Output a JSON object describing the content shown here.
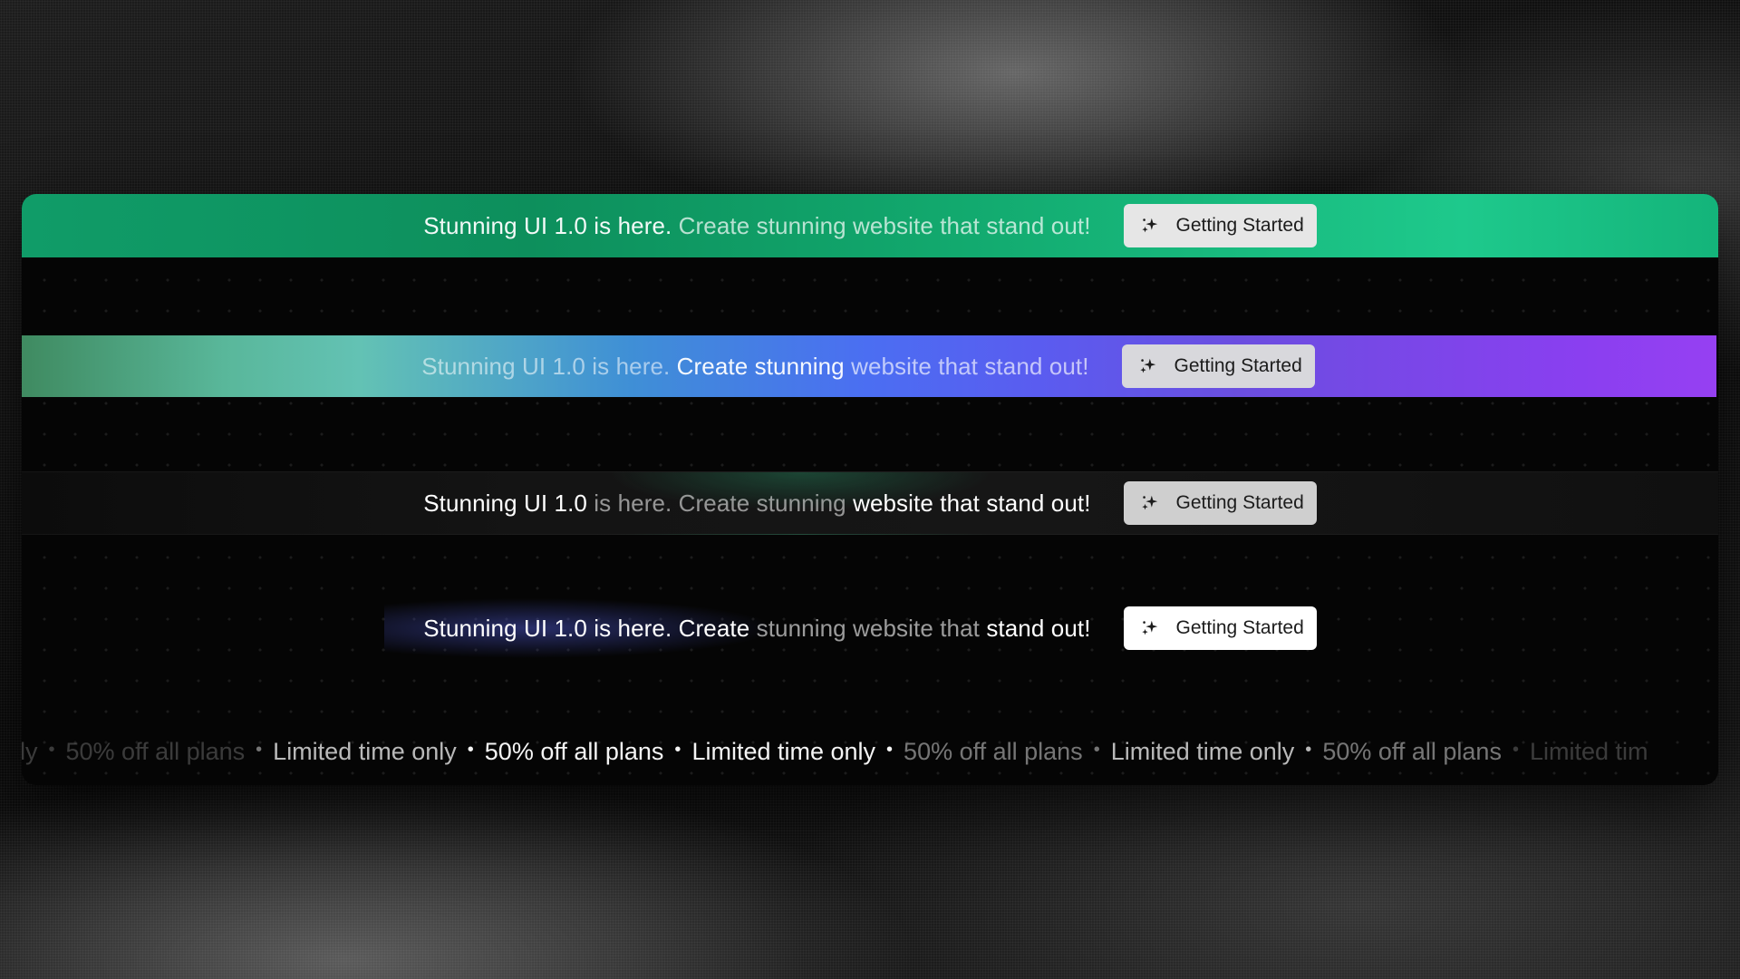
{
  "banners": [
    {
      "part1": "Stunning UI 1.0 is here.",
      "part2": "Create stunning website that stand out!",
      "button_label": "Getting Started",
      "button_icon": "sparkles-icon",
      "style": "green"
    },
    {
      "part1": "Stunning UI 1.0 is here.",
      "part2": "Create stunning",
      "part3": "website that stand out!",
      "button_label": "Getting Started",
      "button_icon": "sparkles-icon",
      "style": "rainbow-gradient"
    },
    {
      "part1": "Stunning UI 1.0",
      "part2": "is here. Create stunning",
      "part3": "website that stand out!",
      "button_label": "Getting Started",
      "button_icon": "sparkles-icon",
      "style": "dark"
    },
    {
      "part1": "Stunning UI 1.0 is here. Create",
      "part2": "stunning website that",
      "part3": "stand out!",
      "button_label": "Getting Started",
      "button_icon": "sparkles-icon",
      "style": "navy-glow"
    }
  ],
  "marquee": {
    "items": [
      "ly",
      "50% off all plans",
      "Limited time only",
      "50% off all plans",
      "Limited time only",
      "50% off all plans",
      "Limited time only",
      "50% off all plans",
      "Limited tim"
    ],
    "separator": "•"
  },
  "colors": {
    "green": "#109c68",
    "rainbow_start": "#59b79a",
    "rainbow_mid": "#4b6ef2",
    "rainbow_end": "#9640f2",
    "panel": "#050505"
  }
}
